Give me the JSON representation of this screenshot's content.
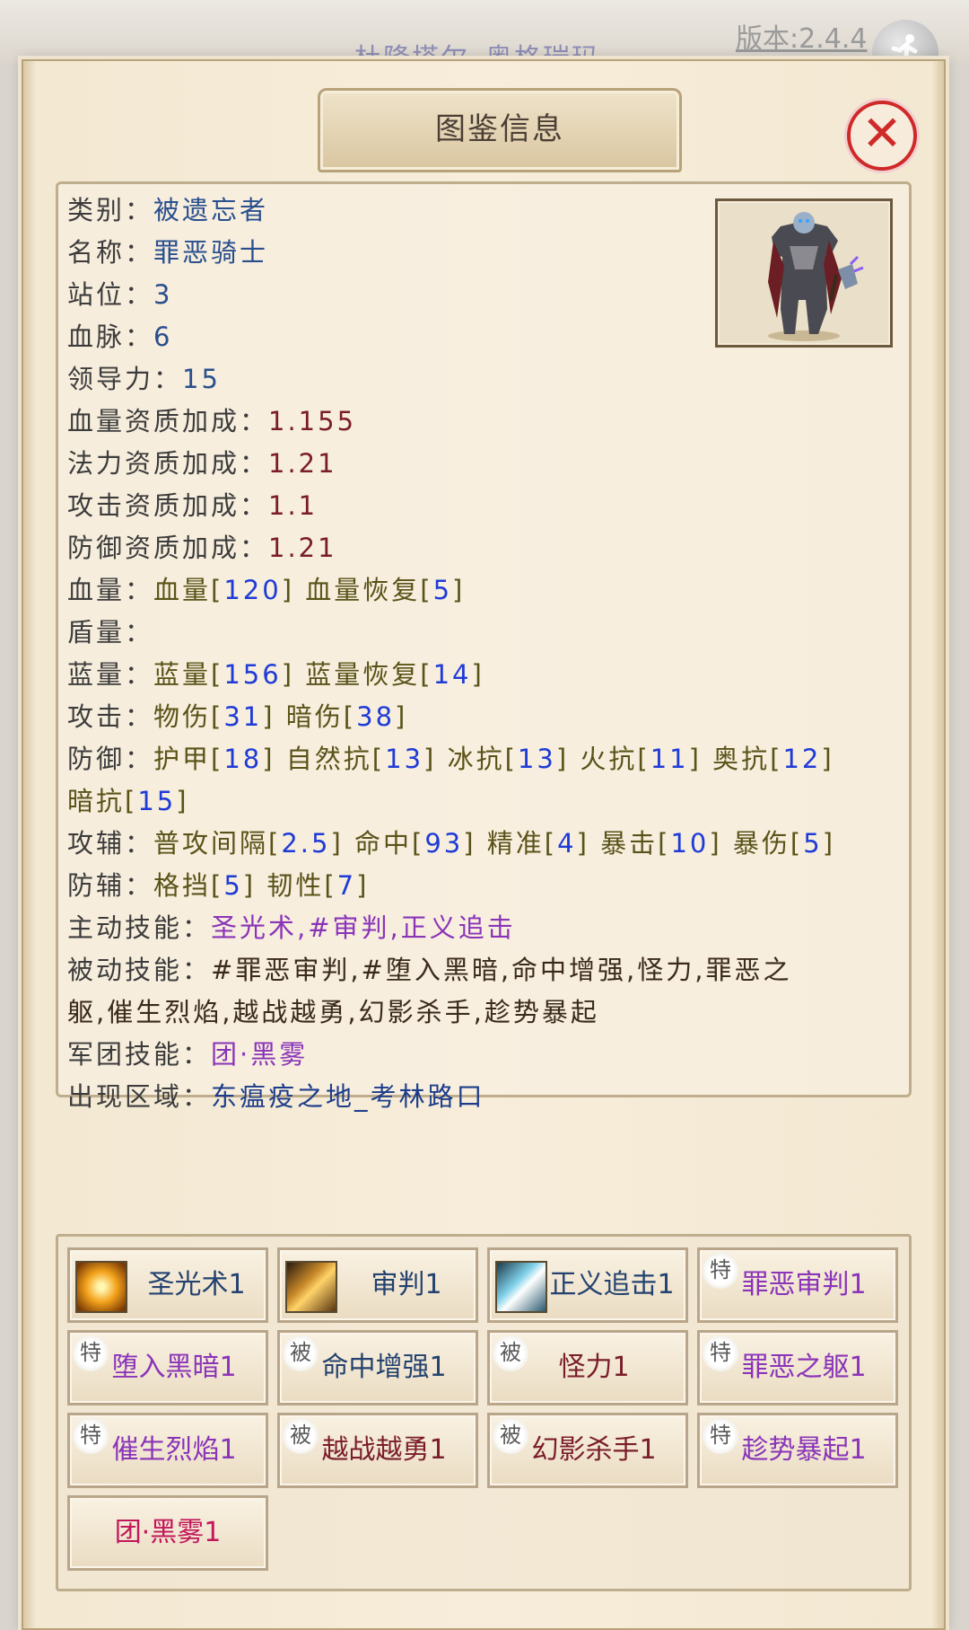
{
  "background": {
    "tabs": [
      "杜隆塔尔",
      "奥格瑞玛"
    ],
    "version": "版本:2.4.4",
    "corner_icon": "running-figure-icon"
  },
  "dialog": {
    "title": "图鉴信息",
    "close_icon": "close-icon",
    "portrait_alt": "knight-portrait"
  },
  "info": {
    "category": {
      "label": "类别：",
      "value": "被遗忘者"
    },
    "name": {
      "label": "名称：",
      "value": "罪恶骑士"
    },
    "position": {
      "label": "站位：",
      "value": "3"
    },
    "bloodline": {
      "label": "血脉：",
      "value": "6"
    },
    "leadership": {
      "label": "领导力：",
      "value": "15"
    },
    "hp_bonus": {
      "label": "血量资质加成：",
      "value": "1.155"
    },
    "mp_bonus": {
      "label": "法力资质加成：",
      "value": "1.21"
    },
    "atk_bonus": {
      "label": "攻击资质加成：",
      "value": "1.1"
    },
    "def_bonus": {
      "label": "防御资质加成：",
      "value": "1.21"
    },
    "hp": {
      "label": "血量：",
      "a_name": "血量[",
      "a_val": "120",
      "a_end": "]",
      "b_name": "血量恢复[",
      "b_val": "5",
      "b_end": "]"
    },
    "shield": {
      "label": "盾量："
    },
    "mp": {
      "label": "蓝量：",
      "a_name": "蓝量[",
      "a_val": "156",
      "a_end": "]",
      "b_name": "蓝量恢复[",
      "b_val": "14",
      "b_end": "]"
    },
    "attack": {
      "label": "攻击：",
      "a_name": "物伤[",
      "a_val": "31",
      "a_end": "]",
      "b_name": "暗伤[",
      "b_val": "38",
      "b_end": "]"
    },
    "defense": {
      "label": "防御：",
      "armor_name": "护甲[",
      "armor_val": "18",
      "nature_name": "自然抗[",
      "nature_val": "13",
      "frost_name": "冰抗[",
      "frost_val": "13",
      "fire_name": "火抗[",
      "fire_val": "11",
      "arcane_name": "奥抗[",
      "arcane_val": "12",
      "shadow_name": "暗抗[",
      "shadow_val": "15",
      "close": "]"
    },
    "atk_aux": {
      "label": "攻辅：",
      "interval_name": "普攻间隔[",
      "interval_val": "2.5",
      "hit_name": "命中[",
      "hit_val": "93",
      "precision_name": "精准[",
      "precision_val": "4",
      "crit_name": "暴击[",
      "crit_val": "10",
      "critdmg_name": "暴伤[",
      "critdmg_val": "5",
      "close": "]"
    },
    "def_aux": {
      "label": "防辅：",
      "block_name": "格挡[",
      "block_val": "5",
      "tough_name": "韧性[",
      "tough_val": "7",
      "close": "]"
    },
    "active_skills": {
      "label": "主动技能：",
      "value": "圣光术,#审判,正义追击"
    },
    "passive_skills": {
      "label": "被动技能：",
      "value_line1": "#罪恶审判,#堕入黑暗,命中增强,怪力,罪恶之",
      "value_line2": "躯,催生烈焰,越战越勇,幻影杀手,趁势暴起"
    },
    "legion_skill": {
      "label": "军团技能：",
      "value": "团·黑雾"
    },
    "region": {
      "label": "出现区域：",
      "value": "东瘟疫之地_考林路口"
    }
  },
  "skills": [
    {
      "label": "圣光术1",
      "icon": "holy-light-icon",
      "color": "#24426f"
    },
    {
      "label": "审判1",
      "icon": "judgement-icon",
      "color": "#24426f"
    },
    {
      "label": "正义追击1",
      "icon": "righteous-pursuit-icon",
      "color": "#24426f"
    },
    {
      "label": "罪恶审判1",
      "badge": "特",
      "color": "#8a34b8"
    },
    {
      "label": "堕入黑暗1",
      "badge": "特",
      "color": "#8a34b8"
    },
    {
      "label": "命中增强1",
      "badge": "被",
      "color": "#24426f"
    },
    {
      "label": "怪力1",
      "badge": "被",
      "color": "#7a1d2a"
    },
    {
      "label": "罪恶之躯1",
      "badge": "特",
      "color": "#8a34b8"
    },
    {
      "label": "催生烈焰1",
      "badge": "特",
      "color": "#8a34b8"
    },
    {
      "label": "越战越勇1",
      "badge": "被",
      "color": "#7a1d2a"
    },
    {
      "label": "幻影杀手1",
      "badge": "被",
      "color": "#7a1d2a"
    },
    {
      "label": "趁势暴起1",
      "badge": "特",
      "color": "#8a34b8"
    },
    {
      "label": "团·黑雾1",
      "color": "#c2185b"
    }
  ]
}
